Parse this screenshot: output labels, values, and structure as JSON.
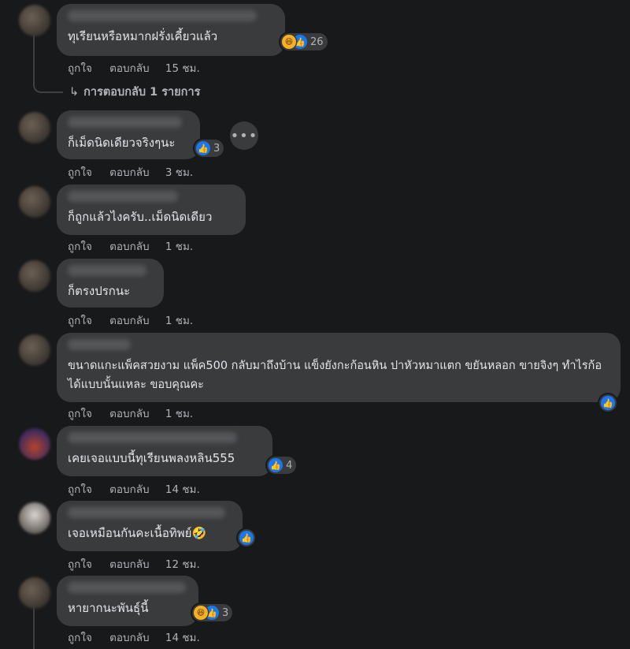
{
  "actions": {
    "like": "ถูกใจ",
    "reply": "ตอบกลับ"
  },
  "comments": [
    {
      "text": "ทุเรียนหรือหมากฝรั่งเคี้ยวแล้ว",
      "time": "15 ชม.",
      "reactions": [
        "haha",
        "like"
      ],
      "count": "26"
    },
    {
      "text": "ก็เม็ดนิดเดียวจริงๆนะ",
      "time": "3 ชม.",
      "reactions": [
        "like"
      ],
      "count": "3"
    },
    {
      "text": "ก็ถูกแล้วไงครับ..เม็ดนิดเดียว",
      "time": "1 ชม."
    },
    {
      "text": "ก็ตรงปรกนะ",
      "time": "1 ชม."
    },
    {
      "text": "ขนาดแกะแพ็คสวยงาม แพ็ค500 กลับมาถึงบ้าน แข็งยังกะก้อนหิน ปาหัวหมาแตก ขยันหลอก ขายจิงๆ ทำไรก้อได้แบบนั้นแหละ ขอบคุณคะ",
      "time": "1 ชม.",
      "reactions": [
        "like"
      ],
      "count": ""
    },
    {
      "text": "เคยเจอแบบนี้ทุเรียนพลงหลิน555",
      "time": "14 ชม.",
      "reactions": [
        "like"
      ],
      "count": "4"
    },
    {
      "text": "เจอเหมือนกันคะเนื้อทิพย์🤣",
      "time": "12 ชม.",
      "reactions": [
        "like"
      ],
      "count": ""
    },
    {
      "text": "หายากนะพันธุ์นี้",
      "time": "14 ชม.",
      "reactions": [
        "haha",
        "like"
      ],
      "count": "3"
    }
  ],
  "replies_link": {
    "arrow": "↳",
    "label": "การตอบกลับ 1 รายการ"
  },
  "more_button": "•••",
  "icons": {
    "like": "thumbs-up-icon",
    "haha": "haha-icon",
    "rofl": "rofl-emoji"
  },
  "colors": {
    "background": "#18191a",
    "bubble": "#3a3b3c",
    "like": "#1877f2",
    "haha": "#f7b125",
    "text": "#e4e6eb",
    "muted": "#b0b3b8"
  }
}
